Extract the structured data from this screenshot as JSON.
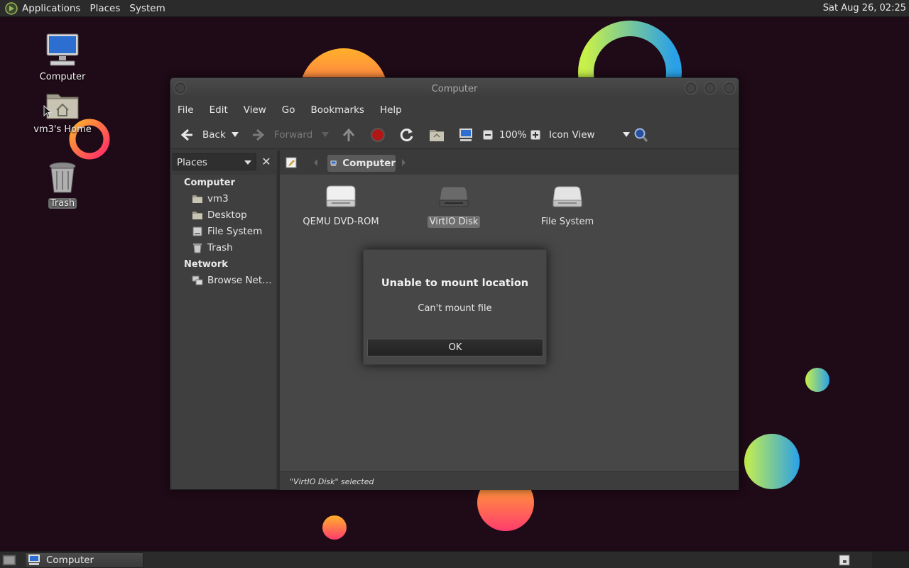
{
  "top_panel": {
    "menus": [
      "Applications",
      "Places",
      "System"
    ],
    "clock": "Sat Aug 26, 02:25"
  },
  "desktop_icons": [
    {
      "label": "Computer",
      "icon": "computer-icon"
    },
    {
      "label": "vm3's Home",
      "icon": "home-folder-icon"
    },
    {
      "label": "Trash",
      "icon": "trash-icon",
      "selected": true
    }
  ],
  "window": {
    "title": "Computer",
    "menu": [
      "File",
      "Edit",
      "View",
      "Go",
      "Bookmarks",
      "Help"
    ],
    "toolbar": {
      "back_label": "Back",
      "forward_label": "Forward",
      "zoom": "100%",
      "view_mode": "Icon View"
    },
    "sidebar": {
      "selector": "Places",
      "sections": [
        {
          "title": "Computer",
          "items": [
            "vm3",
            "Desktop",
            "File System",
            "Trash"
          ]
        },
        {
          "title": "Network",
          "items": [
            "Browse Net…"
          ]
        }
      ]
    },
    "pathbar": {
      "current": "Computer"
    },
    "drives": [
      {
        "label": "QEMU DVD-ROM",
        "icon": "optical-drive-icon"
      },
      {
        "label": "VirtIO Disk",
        "icon": "hard-disk-icon",
        "selected": true
      },
      {
        "label": "File System",
        "icon": "filesystem-drive-icon"
      }
    ],
    "status": "\"VirtIO Disk\" selected"
  },
  "dialog": {
    "title": "Unable to mount location",
    "message": "Can't mount file",
    "ok_label": "OK"
  },
  "taskbar": {
    "task_label": "Computer"
  },
  "colors": {
    "desktop": "#1f0a17",
    "panel": "#2b2b2b",
    "window": "#3a3a3a",
    "content": "#474747"
  }
}
